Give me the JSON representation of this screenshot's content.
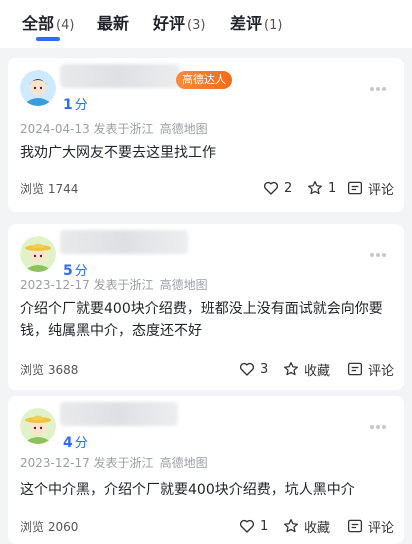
{
  "tabs": [
    {
      "label": "全部",
      "count": "(4)"
    },
    {
      "label": "最新",
      "count": ""
    },
    {
      "label": "好评",
      "count": "(3)"
    },
    {
      "label": "差评",
      "count": "(1)"
    }
  ],
  "reviews": [
    {
      "badge": "高德达人",
      "score": "1",
      "score_unit": "分",
      "date_location": "2024-04-13 发表于浙江",
      "source": "高德地图",
      "content": "我劝广大网友不要去这里找工作",
      "views": "浏览 1744",
      "likes": "2",
      "stars": "1",
      "comment": "评论"
    },
    {
      "score": "5",
      "score_unit": "分",
      "date_location": "2023-12-17 发表于浙江",
      "source": "高德地图",
      "content": "介绍个厂就要400块介绍费，班都没上没有面试就会向你要钱，纯属黑中介，态度还不好",
      "views": "浏览 3688",
      "likes": "3",
      "collect": "收藏",
      "comment": "评论"
    },
    {
      "score": "4",
      "score_unit": "分",
      "date_location": "2023-12-17 发表于浙江",
      "source": "高德地图",
      "content": "这个中介黑，介绍个厂就要400块介绍费，坑人黑中介",
      "views": "浏览 2060",
      "likes": "1",
      "collect": "收藏",
      "comment": "评论"
    }
  ],
  "colors": {
    "accent": "#2f6bff",
    "badge": "#f36b1c"
  }
}
